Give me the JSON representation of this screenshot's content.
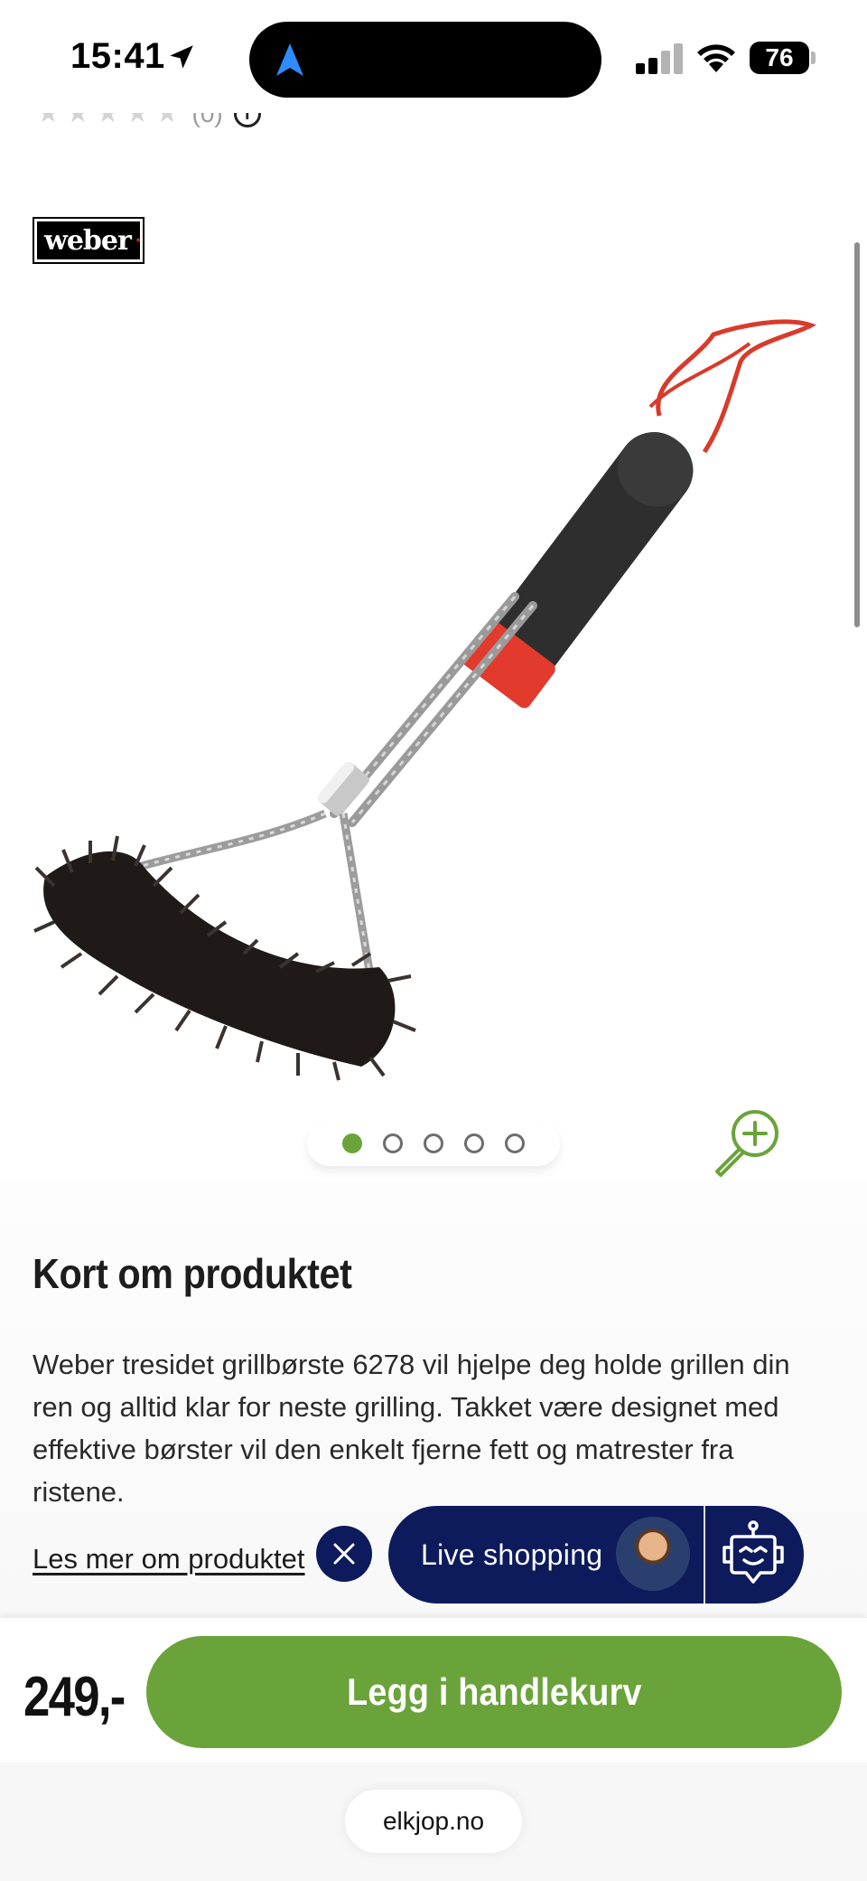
{
  "status_bar": {
    "time": "15:41",
    "battery": "76"
  },
  "rating": {
    "count": "(0)",
    "info": "i"
  },
  "brand": {
    "logo_text": "weber"
  },
  "carousel": {
    "total": 5,
    "active_index": 1
  },
  "product_summary": {
    "title": "Kort om produktet",
    "description": "Weber tresidet grillbørste 6278 vil hjelpe deg holde grillen din ren og alltid klar for neste grilling. Takket være designet med effektive børster vil den enkelt fjerne fett og matrester fra ristene.",
    "read_more": "Les mer om produktet"
  },
  "live_shopping": {
    "label": "Live shopping"
  },
  "purchase": {
    "price": "249,-",
    "cart_button": "Legg i handlekurv"
  },
  "browser": {
    "url": "elkjop.no"
  },
  "colors": {
    "accent_green": "#6aa33a",
    "navy": "#0d1b5c"
  }
}
